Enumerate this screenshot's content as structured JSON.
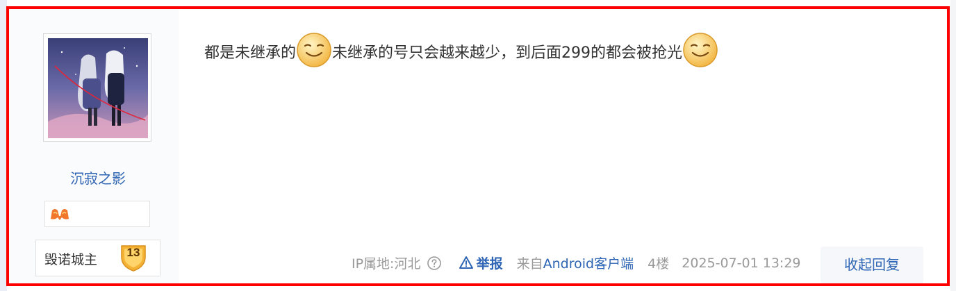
{
  "author": {
    "username": "沉寂之影",
    "level_title": "毁诺城主",
    "level_number": "13"
  },
  "post": {
    "text_part1": "都是未继承的",
    "text_part2": "未继承的号只会越来越少，到后面299的都会被抢光"
  },
  "meta": {
    "ip_location": "IP属地:河北",
    "report_label": "举报",
    "from_prefix": "来自",
    "client_name": "Android客户端",
    "floor": "4楼",
    "datetime": "2025-07-01 13:29"
  },
  "actions": {
    "collapse_reply_label": "收起回复"
  },
  "icons": {
    "emoji": "smiley-emoji-icon",
    "badge": "member-badge-icon",
    "help": "help-circle-icon",
    "report": "warning-triangle-icon"
  },
  "colors": {
    "link_blue": "#2d64b3",
    "meta_gray": "#999999",
    "frame_red": "#ff0000",
    "author_bg": "#fafbfc",
    "level_badge_gold": "#f5b335"
  }
}
